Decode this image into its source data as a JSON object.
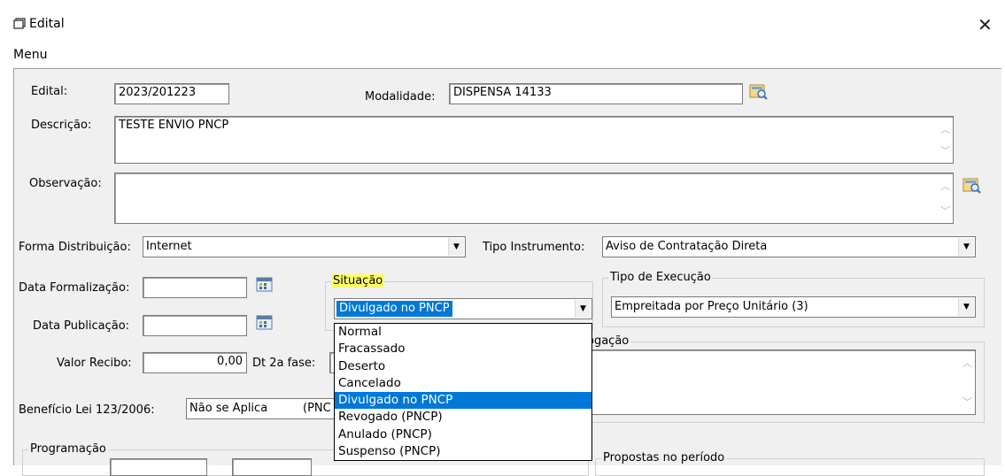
{
  "window": {
    "title": "Edital",
    "close_label": "✕"
  },
  "menubar": {
    "menu_label": "Menu"
  },
  "form": {
    "edital_label": "Edital:",
    "edital_value": "2023/201223",
    "modalidade_label": "Modalidade:",
    "modalidade_value": "DISPENSA 14133",
    "descricao_label": "Descrição:",
    "descricao_value": "TESTE ENVIO PNCP",
    "observacao_label": "Observação:",
    "observacao_value": "",
    "forma_label": "Forma Distribuição:",
    "forma_value": "Internet",
    "tipo_instr_label": "Tipo Instrumento:",
    "tipo_instr_value": "Aviso de Contratação Direta",
    "data_form_label": "Data Formalização:",
    "data_pub_label": "Data Publicação:",
    "valor_recibo_label": "Valor Recibo:",
    "valor_recibo_value": "0,00",
    "dt2a_label": "Dt 2a fase:",
    "beneficio_label": "Benefício Lei 123/2006:",
    "beneficio_value": "Não se Aplica",
    "beneficio_suffix": "(PNC",
    "revogacao_title": "ogação"
  },
  "situacao": {
    "title": "Situação",
    "selected": "Divulgado no PNCP",
    "options": [
      "Normal",
      "Fracassado",
      "Deserto",
      "Cancelado",
      "Divulgado no PNCP",
      "Revogado (PNCP)",
      "Anulado (PNCP)",
      "Suspenso (PNCP)"
    ],
    "selected_index": 4
  },
  "tipo_execucao": {
    "title": "Tipo de Execução",
    "value": "Empreitada por Preço Unitário (3)"
  },
  "programacao": {
    "title": "Programação"
  },
  "propostas": {
    "title": "Propostas no período"
  },
  "colors": {
    "selection": "#0078d7",
    "highlight": "#ffff66",
    "panel": "#f0f0f0"
  }
}
